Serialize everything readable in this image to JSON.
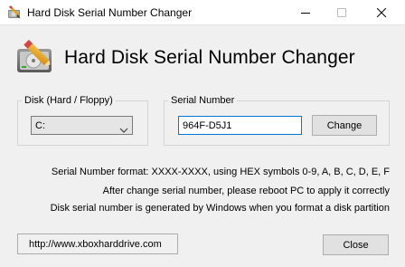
{
  "window": {
    "title": "Hard Disk Serial Number Changer",
    "icon": "pencil-disk-icon",
    "controls": [
      "minimize-icon",
      "maximize-icon",
      "close-icon"
    ]
  },
  "header": {
    "title": "Hard Disk Serial Number Changer",
    "logo": "pencil-disk-icon"
  },
  "disk_group": {
    "label": "Disk (Hard / Floppy)",
    "selected": "C:"
  },
  "serial_group": {
    "label": "Serial Number",
    "value": "964F-D5J1",
    "change_label": "Change"
  },
  "info": {
    "line1": "Serial Number format: XXXX-XXXX, using HEX symbols 0-9, A, B, C, D, E, F",
    "line2": "After change serial number, please reboot PC to apply it correctly",
    "line3": "Disk serial number is generated by Windows when you format a disk partition"
  },
  "footer": {
    "url_label": "http://www.xboxharddrive.com",
    "close_label": "Close"
  },
  "colors": {
    "window_bg": "#f0f0f0",
    "titlebar_bg": "#ffffff",
    "focus_border": "#0078d7",
    "button_bg": "#e1e1e1",
    "button_border": "#adadad"
  }
}
